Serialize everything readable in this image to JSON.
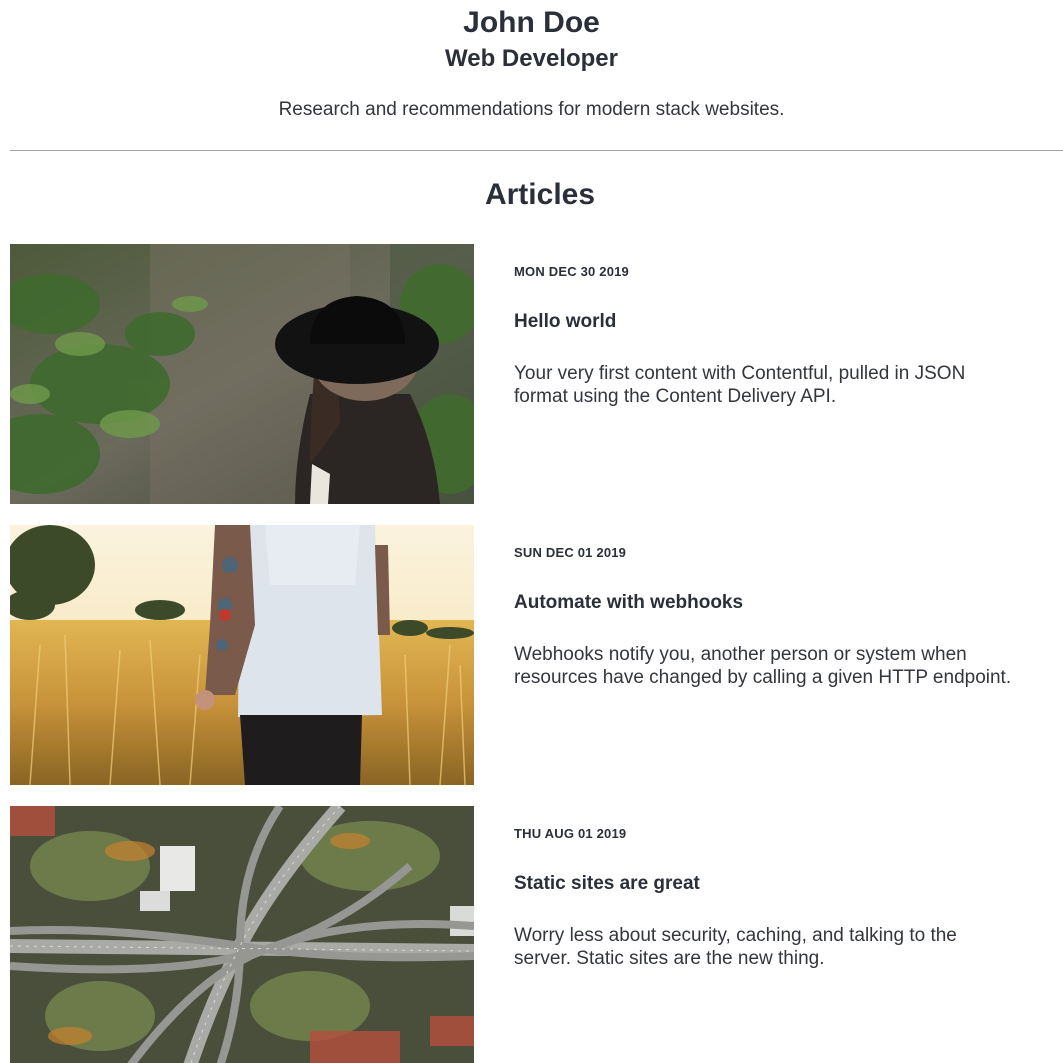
{
  "hero": {
    "name": "John Doe",
    "title": "Web Developer",
    "description": "Research and recommendations for modern stack websites."
  },
  "articles_section": {
    "heading": "Articles"
  },
  "articles": [
    {
      "date": "MON DEC 30 2019",
      "title": "Hello world",
      "excerpt_line1": "Your very first content with Contentful, pulled in JSON",
      "excerpt_line2": "format using the Content Delivery API.",
      "image_subject": "woman-in-black-hat-forest"
    },
    {
      "date": "SUN DEC 01 2019",
      "title": "Automate with webhooks",
      "excerpt_line1": "Webhooks notify you, another person or system when",
      "excerpt_line2": "resources have changed by calling a given HTTP endpoint.",
      "image_subject": "person-in-wheat-field"
    },
    {
      "date": "THU AUG 01 2019",
      "title": "Static sites are great",
      "excerpt_line1": "Worry less about security, caching, and talking to the",
      "excerpt_line2": "server. Static sites are the new thing.",
      "image_subject": "aerial-highway-interchange"
    }
  ],
  "colors": {
    "text": "#2b2f3a",
    "divider": "#a0a0a0",
    "background": "#ffffff"
  }
}
